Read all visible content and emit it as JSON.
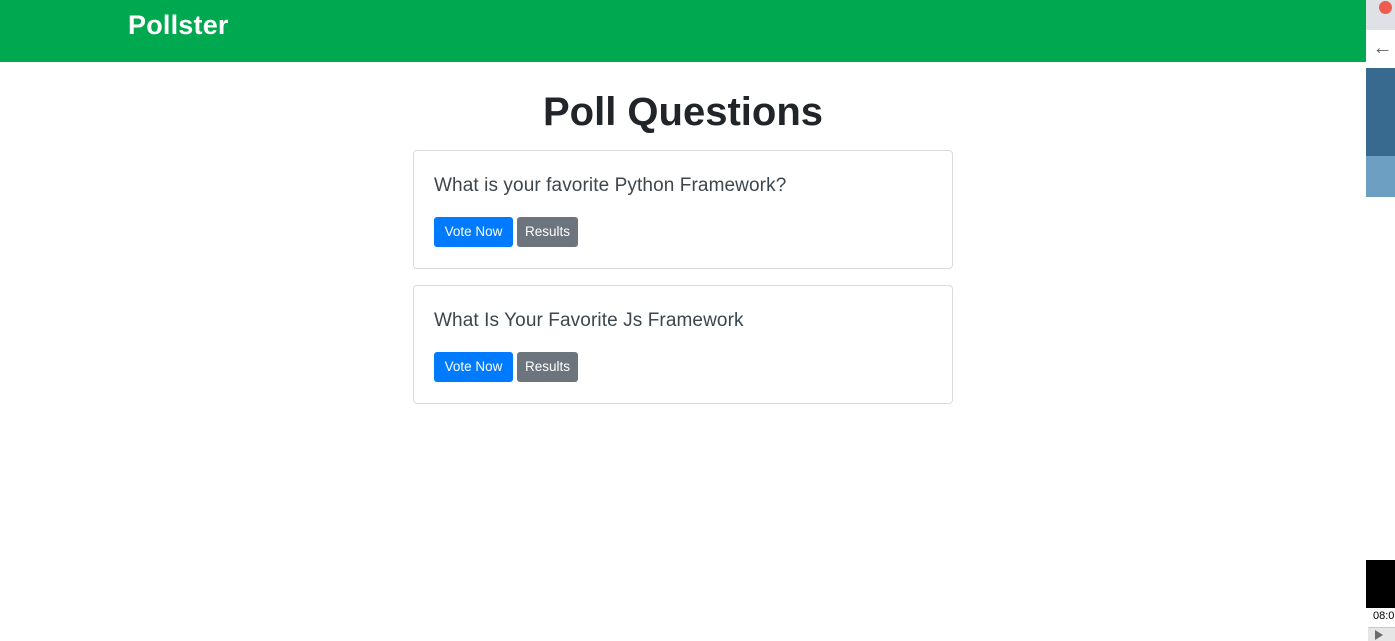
{
  "navbar": {
    "brand": "Pollster",
    "color": "#00a84f"
  },
  "page": {
    "title": "Poll Questions"
  },
  "polls": [
    {
      "question": "What is your favorite Python Framework?",
      "vote_label": "Vote Now",
      "results_label": "Results"
    },
    {
      "question": "What Is Your Favorite Js Framework",
      "vote_label": "Vote Now",
      "results_label": "Results"
    }
  ],
  "colors": {
    "primary_button": "#007bff",
    "secondary_button": "#6c757d"
  },
  "browser_chrome": {
    "back_icon": "arrow-left-icon",
    "time_fragment": "08:0"
  }
}
